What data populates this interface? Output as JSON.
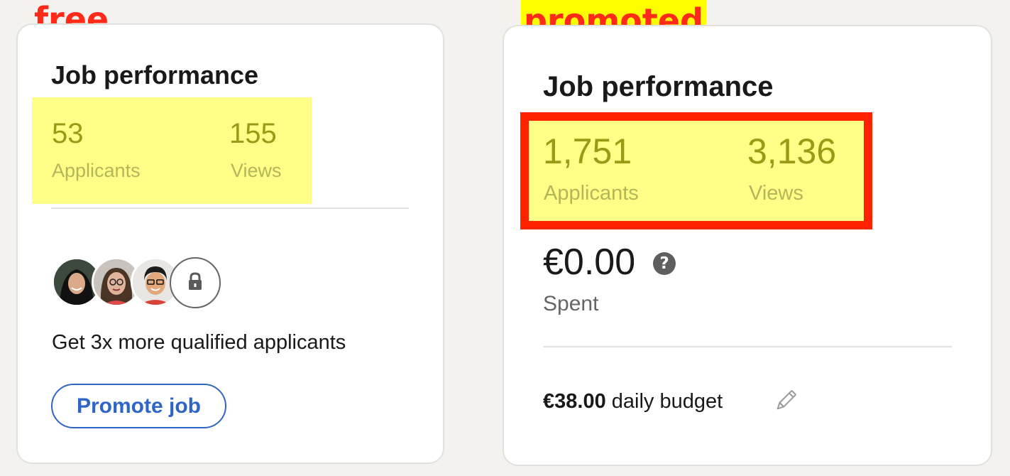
{
  "labels": {
    "free": "free",
    "promoted": "promoted"
  },
  "free_card": {
    "heading": "Job performance",
    "applicants_value": "53",
    "applicants_label": "Applicants",
    "views_value": "155",
    "views_label": "Views",
    "cta_text": "Get 3x more qualified applicants",
    "promote_button": "Promote job",
    "icons": [
      "applicant-avatar",
      "applicant-avatar",
      "applicant-avatar",
      "lock-icon"
    ]
  },
  "promoted_card": {
    "heading": "Job performance",
    "applicants_value": "1,751",
    "applicants_label": "Applicants",
    "views_value": "3,136",
    "views_label": "Views",
    "spent_amount": "€0.00",
    "help_icon": "?",
    "spent_label": "Spent",
    "budget_amount": "€38.00",
    "budget_suffix": " daily budget",
    "icons": [
      "help-icon",
      "pencil-edit-icon"
    ]
  },
  "colors": {
    "annotation_red": "#ff2a18",
    "highlight_yellow": "#ffff88",
    "accent_blue": "#2f65c7",
    "page_background": "#f3f2ef"
  }
}
